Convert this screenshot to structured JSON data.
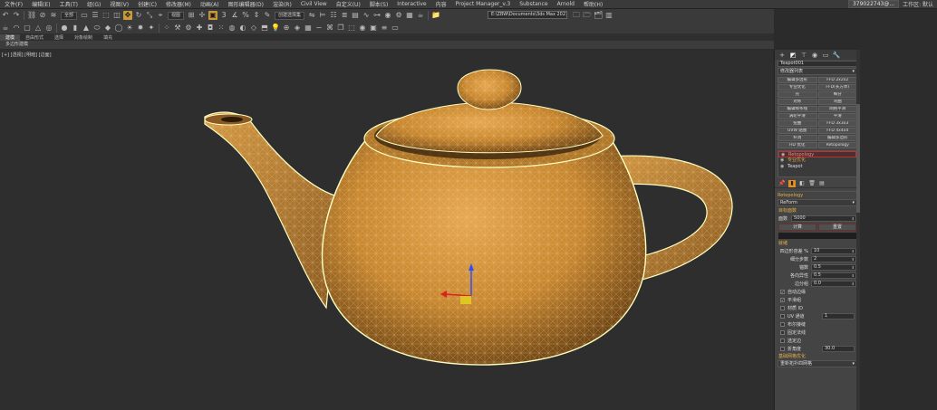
{
  "menubar": {
    "items": [
      "文件(F)",
      "编辑(E)",
      "工具(T)",
      "组(G)",
      "视图(V)",
      "创建(C)",
      "修改器(M)",
      "动画(A)",
      "图形编辑器(D)",
      "渲染(R)",
      "Civil View",
      "自定义(U)",
      "脚本(S)",
      "Interactive",
      "内容",
      "Project Manager_v.3",
      "Substance",
      "Arnold",
      "帮助(H)"
    ],
    "user": "379022743@...",
    "workspace": "工作区: 默认"
  },
  "toolbar1": {
    "filter_select": "全部",
    "view_select": "视图",
    "selection_set": "创建选择集",
    "path": "E:\\ZBW\\Documents\\3ds Max 2021"
  },
  "toolbar2": {
    "icons": [
      "teapot-icon",
      "sphere-icon",
      "box-icon",
      "cylinder-icon",
      "light-icon",
      "camera-icon",
      "helper-icon",
      "shape-icon"
    ]
  },
  "ribbon": {
    "tabs": [
      "建模",
      "自由形式",
      "选择",
      "对象绘制",
      "填充"
    ],
    "active_tab": "建模",
    "panel_label": "多边形建模"
  },
  "viewport": {
    "label": "[+] [透视] [明暗] [边面]"
  },
  "command_panel": {
    "object_name": "Teapot001",
    "object_color": "#e09020",
    "modifier_list": "修改器列表",
    "modifier_buttons": [
      "编辑多边形",
      "FFD 2x2x2",
      "专业优化",
      "FFD(长方体)",
      "壳",
      "细分",
      "对称",
      "弯曲",
      "编辑样条线",
      "网格平滑",
      "涡轮平滑",
      "平滑",
      "扭曲",
      "FFD 3x3x3",
      "UVW 贴图",
      "FFD 4x4x4",
      "补洞",
      "编辑多边形",
      "HD 优化",
      "Retopology"
    ],
    "stack": {
      "items": [
        "Retopology",
        "专业优化",
        "Teapot"
      ],
      "selected_index": 0
    },
    "rollout_title": "Retopology",
    "method_select": "ReForm",
    "target_label": "目标面数",
    "face_count_label": "面数",
    "face_count_value": "5000",
    "compute_label": "计算",
    "reset_label": "重置",
    "status_label": "就绪",
    "params": [
      {
        "label": "四边形容差 %",
        "value": "10"
      },
      {
        "label": "细分步数",
        "value": "2"
      },
      {
        "label": "锚数",
        "value": "0.5"
      },
      {
        "label": "各向异性",
        "value": "0.5"
      },
      {
        "label": "边分组",
        "value": "0.0"
      }
    ],
    "checks": [
      {
        "label": "自动边缘",
        "checked": true
      },
      {
        "label": "平滑组",
        "checked": true
      },
      {
        "label": "材质 ID",
        "checked": false
      },
      {
        "label": "UV 通道",
        "checked": false,
        "value": "1"
      },
      {
        "label": "布尔接缝",
        "checked": false
      },
      {
        "label": "固定法线",
        "checked": false
      },
      {
        "label": "选定边",
        "checked": false
      },
      {
        "label": "折角度",
        "checked": false,
        "value": "30.0"
      }
    ],
    "footer_label": "基础网格优化",
    "footer_select": "重新拓扑四网格"
  }
}
